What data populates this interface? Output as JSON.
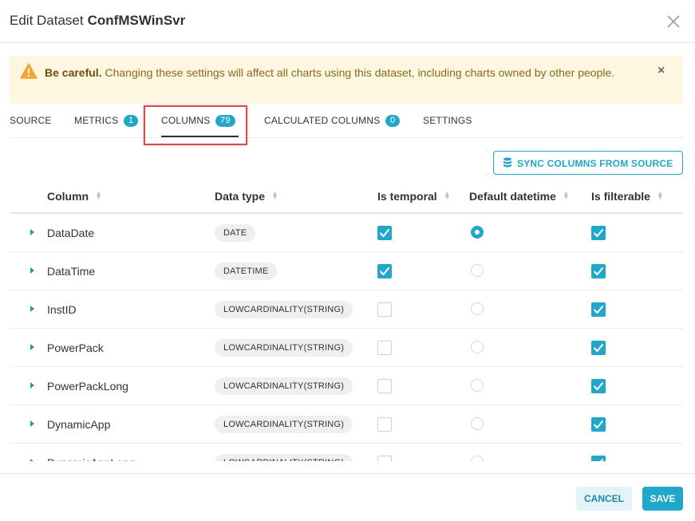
{
  "header": {
    "title_prefix": "Edit Dataset",
    "dataset_name": "ConfMSWinSvr"
  },
  "alert": {
    "bold": "Be careful.",
    "message": "Changing these settings will affect all charts using this dataset, including charts owned by other people.",
    "icon": "warning-icon",
    "close": "×"
  },
  "tabs": [
    {
      "label": "SOURCE",
      "badge": ""
    },
    {
      "label": "METRICS",
      "badge": "1"
    },
    {
      "label": "COLUMNS",
      "badge": "79",
      "active": true
    },
    {
      "label": "CALCULATED COLUMNS",
      "badge": "0"
    },
    {
      "label": "SETTINGS",
      "badge": ""
    }
  ],
  "sync_button": {
    "label": "SYNC COLUMNS FROM SOURCE",
    "icon": "database-icon"
  },
  "table": {
    "headers": {
      "column": "Column",
      "data_type": "Data type",
      "is_temporal": "Is temporal",
      "default_datetime": "Default datetime",
      "is_filterable": "Is filterable"
    },
    "rows": [
      {
        "name": "DataDate",
        "type": "DATE",
        "is_temporal": true,
        "default_datetime": true,
        "is_filterable": true
      },
      {
        "name": "DataTime",
        "type": "DATETIME",
        "is_temporal": true,
        "default_datetime": false,
        "is_filterable": true
      },
      {
        "name": "InstID",
        "type": "LOWCARDINALITY(STRING)",
        "is_temporal": false,
        "default_datetime": false,
        "is_filterable": true
      },
      {
        "name": "PowerPack",
        "type": "LOWCARDINALITY(STRING)",
        "is_temporal": false,
        "default_datetime": false,
        "is_filterable": true
      },
      {
        "name": "PowerPackLong",
        "type": "LOWCARDINALITY(STRING)",
        "is_temporal": false,
        "default_datetime": false,
        "is_filterable": true
      },
      {
        "name": "DynamicApp",
        "type": "LOWCARDINALITY(STRING)",
        "is_temporal": false,
        "default_datetime": false,
        "is_filterable": true
      },
      {
        "name": "DynamicAppLong",
        "type": "LOWCARDINALITY(STRING)",
        "is_temporal": false,
        "default_datetime": false,
        "is_filterable": true
      }
    ]
  },
  "footer": {
    "cancel": "CANCEL",
    "save": "SAVE"
  },
  "colors": {
    "accent": "#20a7c9",
    "warning_bg": "#fdf7e1",
    "highlight": "#e0494c"
  }
}
